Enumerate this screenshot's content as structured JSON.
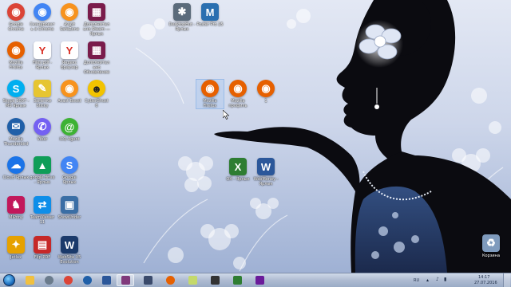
{
  "desktop": {
    "icons": [
      {
        "label": "Google Chrome",
        "color": "#db4437",
        "glyph": "◉"
      },
      {
        "label": "Сканировать в Chrome",
        "color": "#4285f4",
        "glyph": "◉"
      },
      {
        "label": "Avast SafeZone",
        "color": "#f7931e",
        "glyph": "◉"
      },
      {
        "label": "Дополнительно Steam — Ярлык",
        "color": "#7a1c4b",
        "glyph": "▦"
      },
      {
        "label": "Mozilla Firefox",
        "color": "#e66000",
        "glyph": "◉"
      },
      {
        "label": "Files pdf - Ярлык",
        "color": "#d93025",
        "glyph": "Y"
      },
      {
        "label": "Яндекс Браузер",
        "color": "#d93025",
        "glyph": "Y"
      },
      {
        "label": "Дополнительно Обновление",
        "color": "#7a1c4b",
        "glyph": "▦"
      },
      {
        "label": "Skype 2007 - MS Ярлык",
        "color": "#00aff0",
        "glyph": "S"
      },
      {
        "label": "Заметки Sticky",
        "color": "#e6c531",
        "glyph": "✎"
      },
      {
        "label": "Avast Boost",
        "color": "#f7931e",
        "glyph": "◉"
      },
      {
        "label": "CyberGhost 6",
        "color": "#f2c300",
        "glyph": "☻"
      },
      {
        "label": "Mozilla Thunderbird",
        "color": "#1f5fa8",
        "glyph": "✉"
      },
      {
        "label": "Viber",
        "color": "#7360f2",
        "glyph": "✆"
      },
      {
        "label": "ICQ Agent",
        "color": "#3db234",
        "glyph": "@"
      },
      {
        "label": "Cloud Ярлык",
        "color": "#1a73e8",
        "glyph": "☁"
      },
      {
        "label": "google drive - Ярлык",
        "color": "#0f9d58",
        "glyph": "▲"
      },
      {
        "label": "Google Ярлык",
        "color": "#4285f4",
        "glyph": "S"
      },
      {
        "label": "MiPony",
        "color": "#c2185b",
        "glyph": "♞"
      },
      {
        "label": "TeamViewer 11",
        "color": "#0e8ee9",
        "glyph": "⇄"
      },
      {
        "label": "ShowUnder",
        "color": "#3a6ea5",
        "glyph": "▣"
      },
      {
        "label": "Jetlax",
        "color": "#e6a100",
        "glyph": "✦"
      },
      {
        "label": "Flip PDF",
        "color": "#c62828",
        "glyph": "▤"
      },
      {
        "label": "WebSite X5 Evolution",
        "color": "#1b3a6b",
        "glyph": "W"
      },
      {
        "label": "DesktopHut - Ярлык",
        "color": "#5b6b7b",
        "glyph": "✱"
      },
      {
        "label": "Poster Pro 25",
        "color": "#2a6fb0",
        "glyph": "M"
      },
      {
        "label": "Mozilla Firefox",
        "color": "#e66000",
        "glyph": "◉"
      },
      {
        "label": "Mozilla профиль",
        "color": "#e66000",
        "glyph": "◉"
      },
      {
        "label": "1",
        "color": "#e66000",
        "glyph": "◉"
      },
      {
        "label": "ОК - Ярлык",
        "color": "#2e7d32",
        "glyph": "X"
      },
      {
        "label": "WebMoney - Ярлык",
        "color": "#2b579a",
        "glyph": "W"
      },
      {
        "label": "Корзина",
        "color": "#7f9bbd",
        "glyph": "🗑"
      }
    ]
  },
  "taskbar": {
    "buttons": [
      {
        "name": "taskbar-explorer",
        "color": "#f0c040"
      },
      {
        "name": "taskbar-spider",
        "color": "#6a7b8c"
      },
      {
        "name": "taskbar-chrome",
        "color": "#db4437"
      },
      {
        "name": "taskbar-thunderbird",
        "color": "#1f5fa8"
      },
      {
        "name": "taskbar-word",
        "color": "#2b579a"
      },
      {
        "name": "taskbar-onenote",
        "color": "#80397b"
      },
      {
        "name": "taskbar-save",
        "color": "#3a4a6b"
      },
      {
        "name": "taskbar-firefox",
        "color": "#e66000"
      },
      {
        "name": "taskbar-notes",
        "color": "#c4d96b"
      },
      {
        "name": "taskbar-camera",
        "color": "#333333"
      },
      {
        "name": "taskbar-paint",
        "color": "#2e7d32"
      },
      {
        "name": "taskbar-gallery",
        "color": "#6a1b9a"
      }
    ],
    "tray": {
      "language": "RU",
      "time": "14:17",
      "date": "27.07.2016"
    }
  }
}
